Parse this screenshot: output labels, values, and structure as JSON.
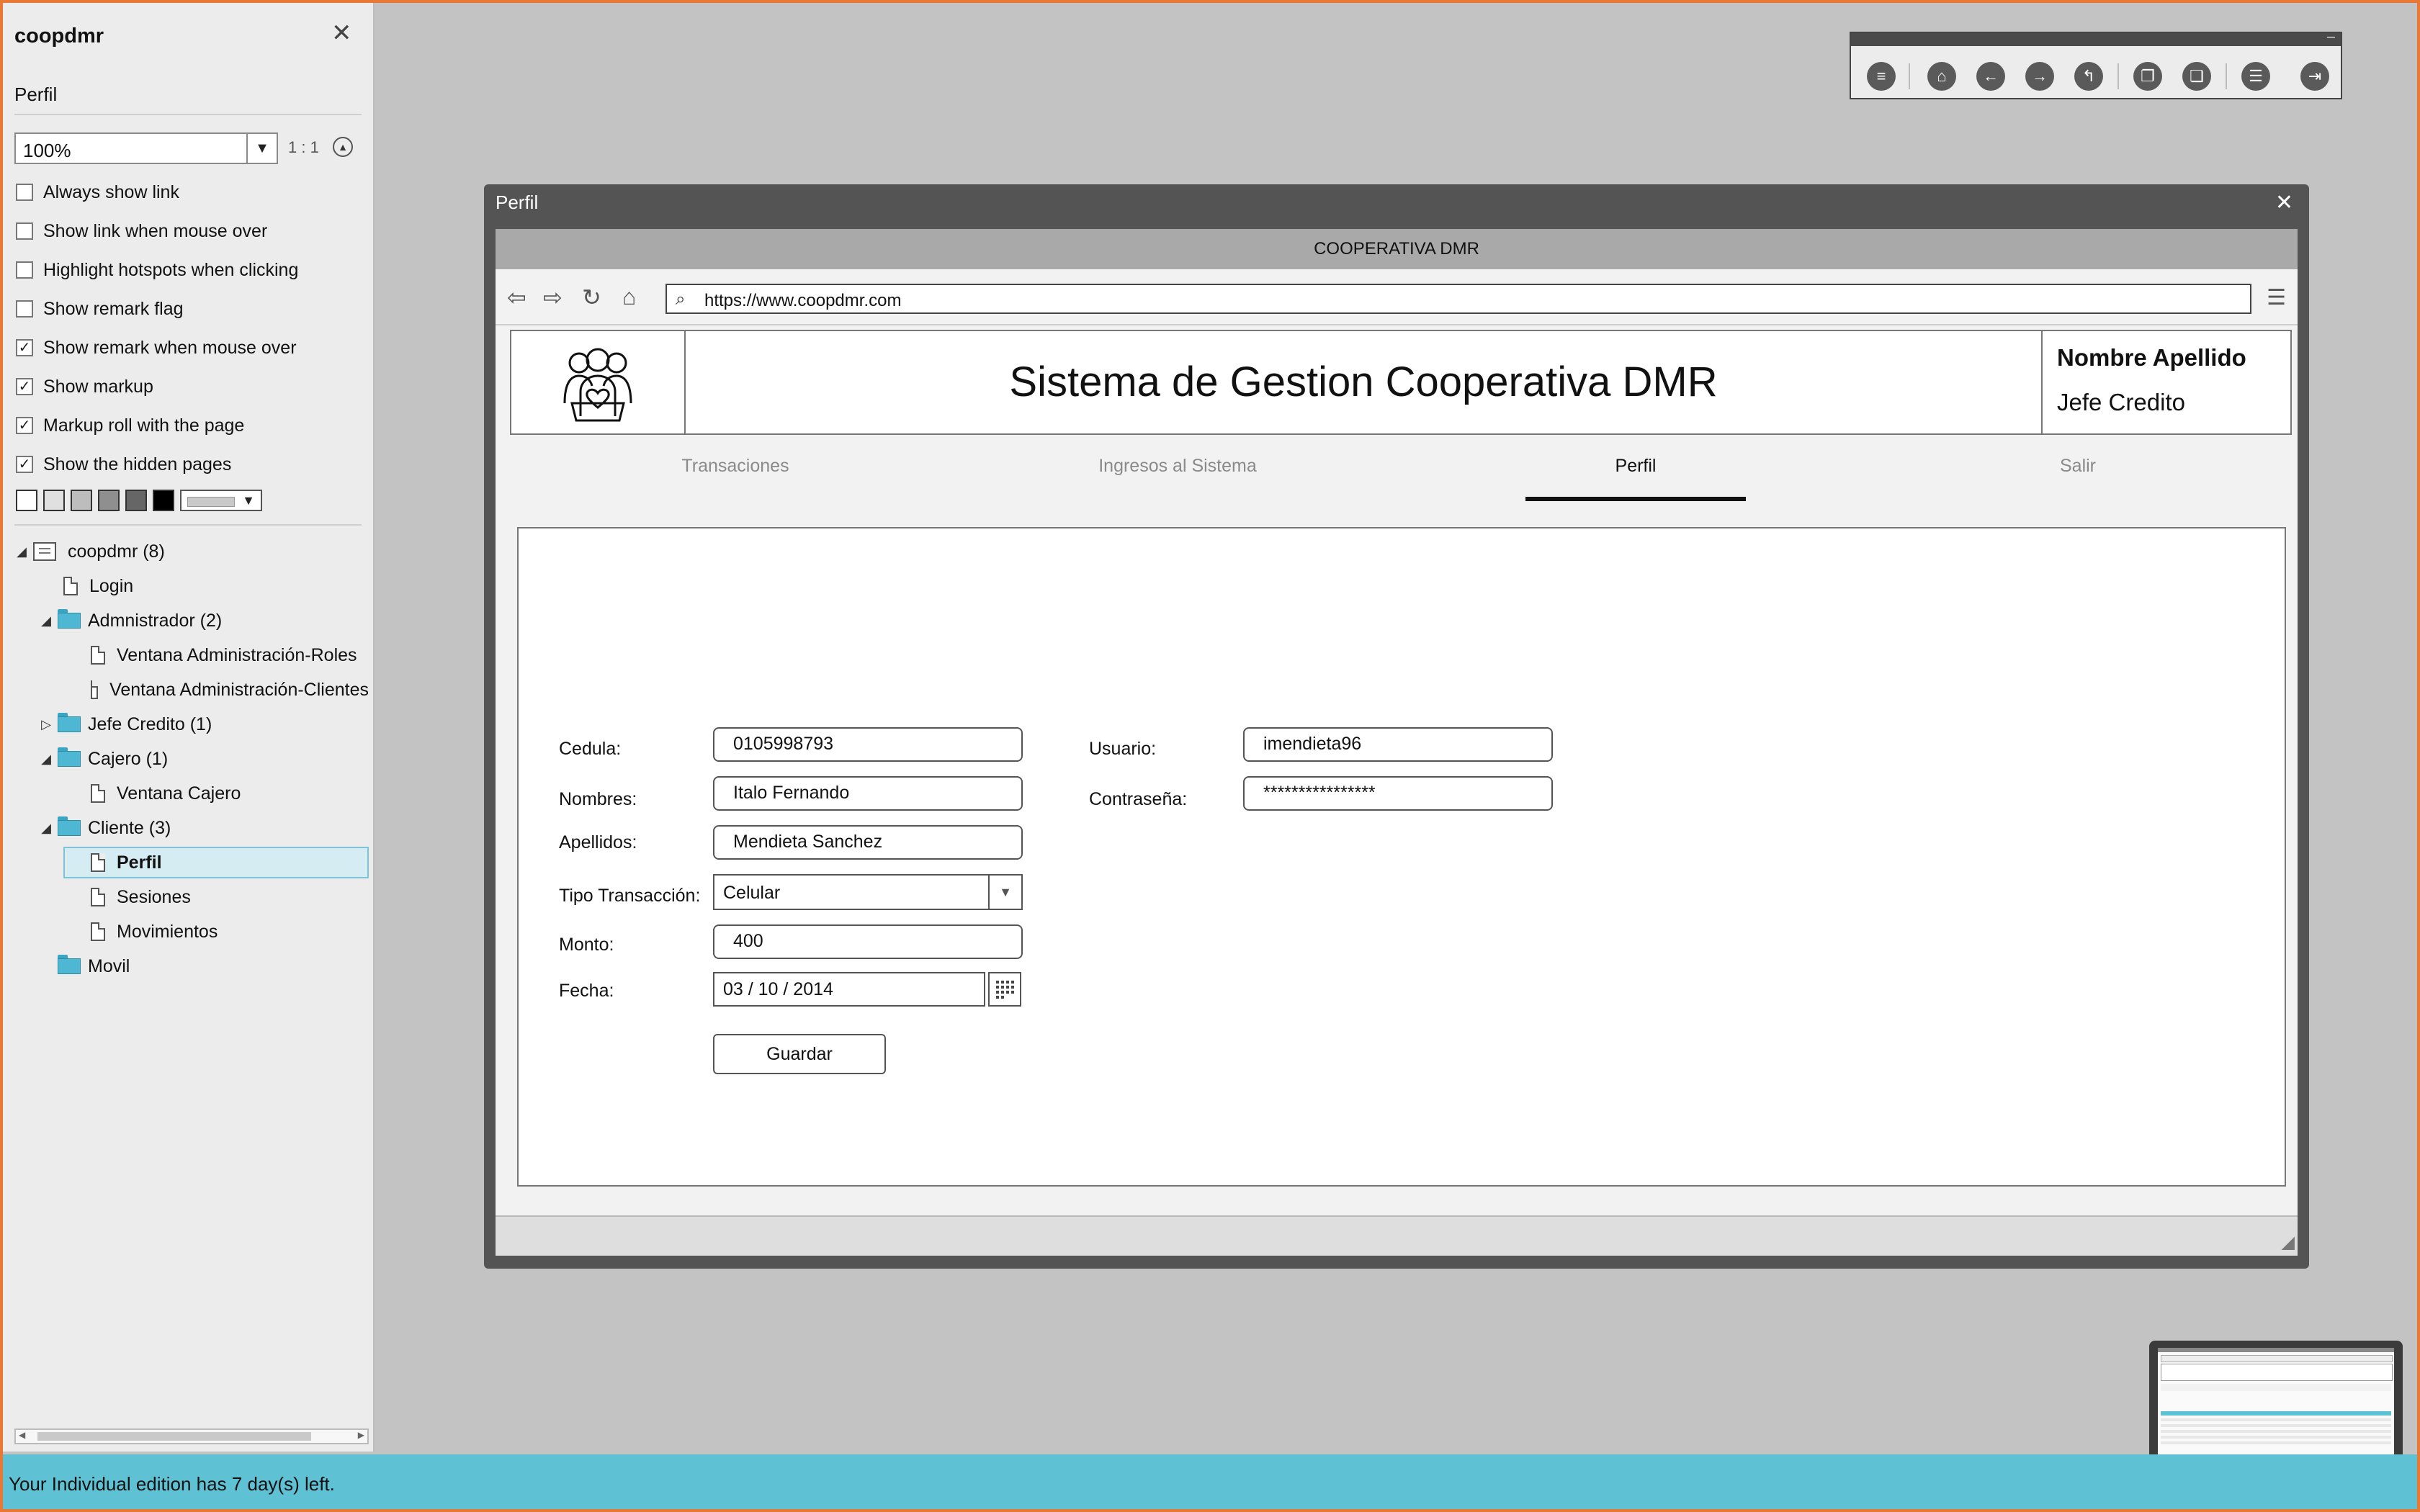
{
  "sidebar": {
    "title": "coopdmr",
    "subtitle": "Perfil",
    "zoom": {
      "value": "100%",
      "ratio": "1 : 1"
    },
    "options": [
      {
        "label": "Always show link",
        "checked": false
      },
      {
        "label": "Show link when mouse over",
        "checked": false
      },
      {
        "label": "Highlight hotspots when clicking",
        "checked": false
      },
      {
        "label": "Show remark flag",
        "checked": false
      },
      {
        "label": "Show remark when mouse over",
        "checked": true
      },
      {
        "label": "Show markup",
        "checked": true
      },
      {
        "label": "Markup roll with the page",
        "checked": true
      },
      {
        "label": "Show the hidden pages",
        "checked": true
      }
    ],
    "swatch_colors": [
      "#ffffff",
      "#e0e0e0",
      "#bdbdbd",
      "#8f8f8f",
      "#666666",
      "#000000"
    ],
    "tree": [
      {
        "label": "coopdmr (8)",
        "type": "root",
        "expanded": true
      },
      {
        "label": "Login",
        "type": "page"
      },
      {
        "label": "Admnistrador (2)",
        "type": "folder",
        "expanded": true
      },
      {
        "label": "Ventana Administración-Roles",
        "type": "page"
      },
      {
        "label": "Ventana Administración-Clientes",
        "type": "page"
      },
      {
        "label": "Jefe Credito (1)",
        "type": "folder",
        "expanded": false
      },
      {
        "label": "Cajero (1)",
        "type": "folder",
        "expanded": true
      },
      {
        "label": "Ventana Cajero",
        "type": "page"
      },
      {
        "label": "Cliente (3)",
        "type": "folder",
        "expanded": true
      },
      {
        "label": "Perfil",
        "type": "page",
        "selected": true
      },
      {
        "label": "Sesiones",
        "type": "page"
      },
      {
        "label": "Movimientos",
        "type": "page"
      },
      {
        "label": "Movil",
        "type": "folder"
      }
    ]
  },
  "status_bar": {
    "text": "Your Individual edition has 7 day(s) left."
  },
  "toolbar": {
    "buttons": [
      "menu-icon",
      "home-icon",
      "back-arrow-icon",
      "forward-arrow-icon",
      "up-level-icon",
      "copy-page-icon",
      "paste-page-icon",
      "document-icon",
      "exit-icon"
    ]
  },
  "window": {
    "title": "Perfil",
    "browser": {
      "title": "COOPERATIVA DMR",
      "url": "https://www.coopdmr.com"
    },
    "page": {
      "site_title": "Sistema de Gestion Cooperativa DMR",
      "user_name": "Nombre Apellido",
      "user_role": "Jefe Credito",
      "tabs": [
        "Transaciones",
        "Ingresos al Sistema",
        "Perfil",
        "Salir"
      ],
      "active_tab": "Perfil",
      "form": {
        "cedula_label": "Cedula:",
        "cedula_value": "0105998793",
        "nombres_label": "Nombres:",
        "nombres_value": "Italo Fernando",
        "apellidos_label": "Apellidos:",
        "apellidos_value": "Mendieta Sanchez",
        "tipo_label": "Tipo Transacción:",
        "tipo_value": "Celular",
        "monto_label": "Monto:",
        "monto_value": "400",
        "fecha_label": "Fecha:",
        "fecha_value": "03 / 10 / 2014",
        "usuario_label": "Usuario:",
        "usuario_value": "imendieta96",
        "password_label": "Contraseña:",
        "password_value": "****************",
        "save_label": "Guardar"
      }
    }
  },
  "colors": {
    "accent": "#5fc1d4",
    "window": "#545454",
    "frame": "#e87834"
  }
}
